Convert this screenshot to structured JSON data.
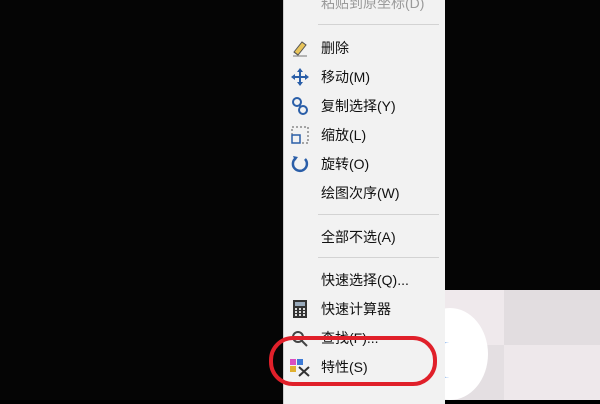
{
  "menu": {
    "items": [
      {
        "id": "paste-to-origin",
        "label": "粘贴到原坐标(D)",
        "icon": "none",
        "disabled": true
      },
      {
        "id": "delete",
        "label": "删除",
        "icon": "eraser-icon",
        "disabled": false
      },
      {
        "id": "move",
        "label": "移动(M)",
        "icon": "move-arrows-icon",
        "disabled": false
      },
      {
        "id": "copy-selection",
        "label": "复制选择(Y)",
        "icon": "copy-nodes-icon",
        "disabled": false
      },
      {
        "id": "scale",
        "label": "缩放(L)",
        "icon": "scale-icon",
        "disabled": false
      },
      {
        "id": "rotate",
        "label": "旋转(O)",
        "icon": "rotate-icon",
        "disabled": false
      },
      {
        "id": "draw-order",
        "label": "绘图次序(W)",
        "icon": "none",
        "disabled": false
      },
      {
        "id": "deselect-all",
        "label": "全部不选(A)",
        "icon": "none",
        "disabled": false
      },
      {
        "id": "quick-select",
        "label": "快速选择(Q)...",
        "icon": "none",
        "disabled": false
      },
      {
        "id": "quick-calc",
        "label": "快速计算器",
        "icon": "calculator-icon",
        "disabled": false
      },
      {
        "id": "find",
        "label": "查找(F)...",
        "icon": "find-icon",
        "disabled": false
      },
      {
        "id": "properties",
        "label": "特性(S)",
        "icon": "properties-icon",
        "disabled": false
      }
    ]
  },
  "colors": {
    "highlight": "#e0202a",
    "accent": "#1e6fd9",
    "menu_bg": "#f2f2f2"
  }
}
